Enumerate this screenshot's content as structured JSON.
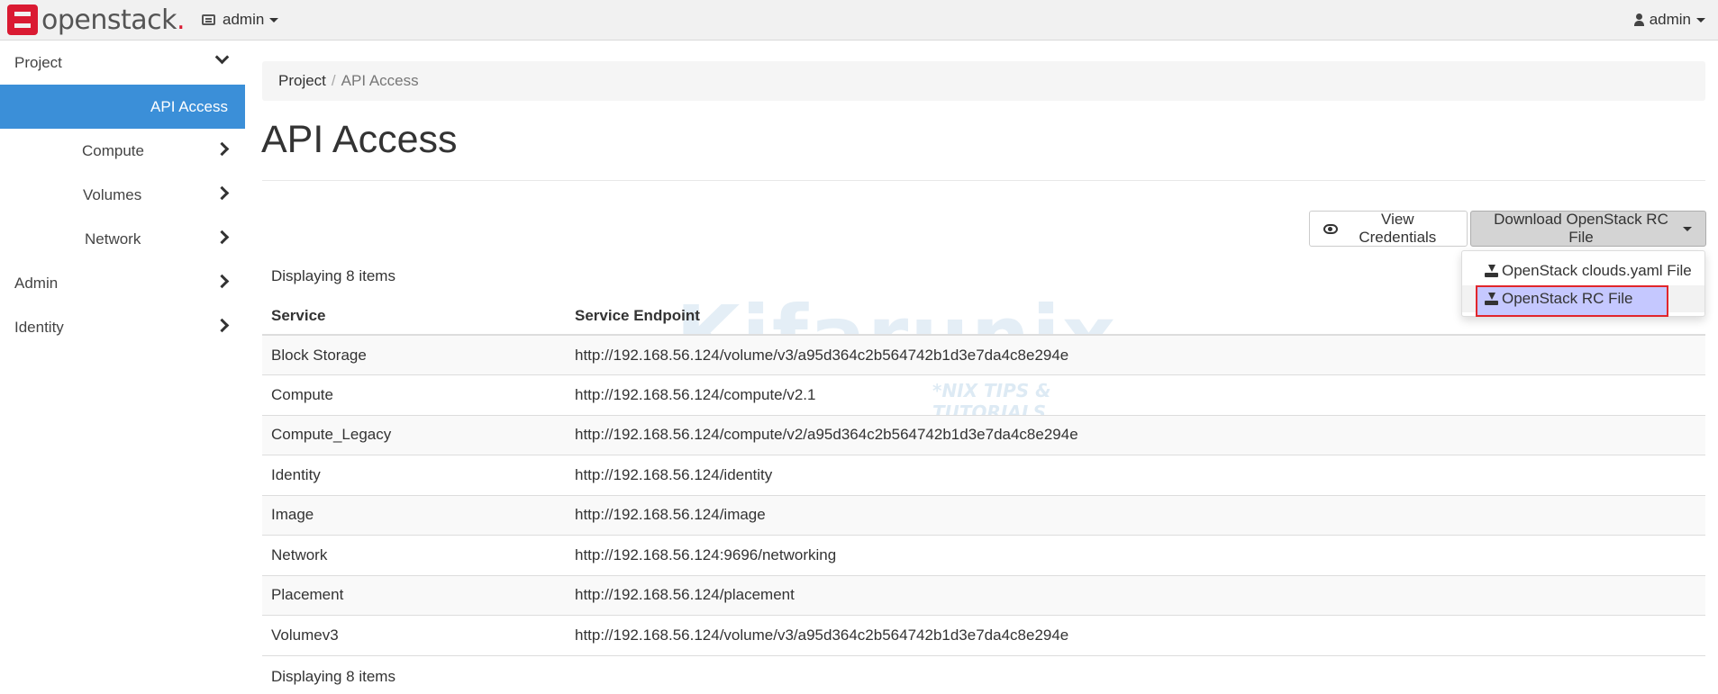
{
  "brand": {
    "name": "openstack",
    "dot": "."
  },
  "topbar": {
    "project": "admin",
    "user": "admin"
  },
  "sidebar": {
    "items": [
      {
        "label": "Project"
      },
      {
        "label": "API Access"
      },
      {
        "label": "Compute"
      },
      {
        "label": "Volumes"
      },
      {
        "label": "Network"
      },
      {
        "label": "Admin"
      },
      {
        "label": "Identity"
      }
    ]
  },
  "breadcrumb": {
    "root": "Project",
    "sep": "/",
    "current": "API Access"
  },
  "page": {
    "title": "API Access"
  },
  "actions": {
    "view_credentials": "View Credentials",
    "download_rc": "Download OpenStack RC File",
    "dropdown": [
      {
        "label": "OpenStack clouds.yaml File"
      },
      {
        "label": "OpenStack RC File"
      }
    ]
  },
  "table": {
    "count_label": "Displaying 8 items",
    "headers": [
      "Service",
      "Service Endpoint"
    ],
    "rows": [
      [
        "Block Storage",
        "http://192.168.56.124/volume/v3/a95d364c2b564742b1d3e7da4c8e294e"
      ],
      [
        "Compute",
        "http://192.168.56.124/compute/v2.1"
      ],
      [
        "Compute_Legacy",
        "http://192.168.56.124/compute/v2/a95d364c2b564742b1d3e7da4c8e294e"
      ],
      [
        "Identity",
        "http://192.168.56.124/identity"
      ],
      [
        "Image",
        "http://192.168.56.124/image"
      ],
      [
        "Network",
        "http://192.168.56.124:9696/networking"
      ],
      [
        "Placement",
        "http://192.168.56.124/placement"
      ],
      [
        "Volumev3",
        "http://192.168.56.124/volume/v3/a95d364c2b564742b1d3e7da4c8e294e"
      ]
    ]
  },
  "watermark": {
    "text": "Kifarunix",
    "sub": "*NIX TIPS & TUTORIALS"
  }
}
